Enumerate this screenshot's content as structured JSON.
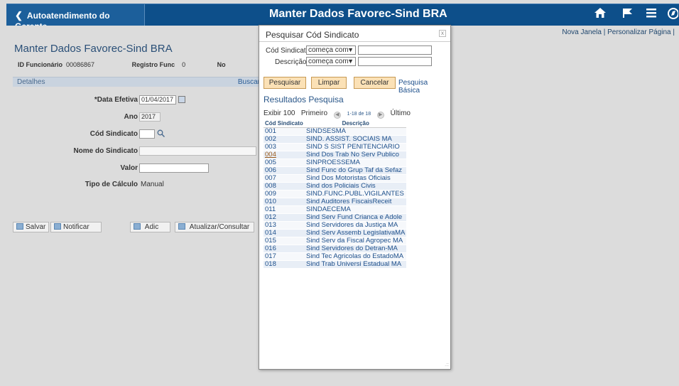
{
  "header": {
    "back_label": "Autoatendimento do Gerente",
    "title": "Manter Dados Favorec-Sind BRA",
    "icons": [
      "home-icon",
      "flag-icon",
      "menu-icon",
      "navbar-icon"
    ]
  },
  "links": {
    "new_window": "Nova Janela",
    "separator": "|",
    "personalize": "Personalizar Página",
    "separator2": "|"
  },
  "page": {
    "title": "Manter Dados Favorec-Sind BRA",
    "id_label": "ID Funcionário",
    "id_value": "00086867",
    "registro_label": "Registro Func",
    "registro_value": "0",
    "no_label": "No",
    "details_label": "Detalhes",
    "search_link": "Buscar",
    "fields": {
      "data_efetiva_label": "*Data Efetiva",
      "data_efetiva_value": "01/04/2017",
      "ano_label": "Ano",
      "ano_value": "2017",
      "cod_sindicato_label": "Cód Sindicato",
      "cod_sindicato_value": "",
      "nome_sindicato_label": "Nome do Sindicato",
      "nome_sindicato_value": "",
      "valor_label": "Valor",
      "valor_value": "",
      "tipo_calculo_label": "Tipo de Cálculo",
      "tipo_calculo_value": "Manual"
    },
    "buttons": {
      "save": "Salvar",
      "notify": "Notificar",
      "add": "Adic",
      "update": "Atualizar/Consultar"
    }
  },
  "modal": {
    "title": "Pesquisar Cód Sindicato",
    "close": "x",
    "cod_label": "Cód Sindicato",
    "cod_operator": "começa com",
    "cod_value": "",
    "desc_label": "Descrição",
    "desc_operator": "começa com",
    "desc_value": "",
    "buttons": {
      "search": "Pesquisar",
      "clear": "Limpar",
      "cancel": "Cancelar"
    },
    "basic_search": "Pesquisa Básica",
    "results_title": "Resultados Pesquisa",
    "nav": {
      "show": "Exibir 100",
      "first": "Primeiro",
      "range": "1-18 de 18",
      "last": "Último"
    },
    "columns": [
      "Cód Sindicato",
      "Descrição"
    ],
    "rows": [
      [
        "001",
        "SINDSESMA"
      ],
      [
        "002",
        "SIND. ASSIST. SOCIAIS MA"
      ],
      [
        "003",
        "SIND S SIST PENITENCIARIO"
      ],
      [
        "004",
        "Sind Dos Trab No Serv Publico"
      ],
      [
        "005",
        "SINPROESSEMA"
      ],
      [
        "006",
        "Sind Func do Grup Taf da Sefaz"
      ],
      [
        "007",
        "Sind Dos Motoristas Oficiais"
      ],
      [
        "008",
        "Sind dos Policiais Civis"
      ],
      [
        "009",
        "SIND.FUNC.PUBL.VIGILANTES"
      ],
      [
        "010",
        "Sind Auditores FiscaisReceit"
      ],
      [
        "011",
        "SINDAECEMA"
      ],
      [
        "012",
        "Sind Serv Fund Crianca e Adole"
      ],
      [
        "013",
        "Sind Servidores da Justiça MA"
      ],
      [
        "014",
        "Sind Serv Assemb LegislativaMA"
      ],
      [
        "015",
        "Sind Serv da Fiscal Agropec MA"
      ],
      [
        "016",
        "Sind Servidores do Detran-MA"
      ],
      [
        "017",
        "Sind Tec Agricolas do EstadoMA"
      ],
      [
        "018",
        "Sind Trab Universi Estadual MA"
      ]
    ]
  }
}
